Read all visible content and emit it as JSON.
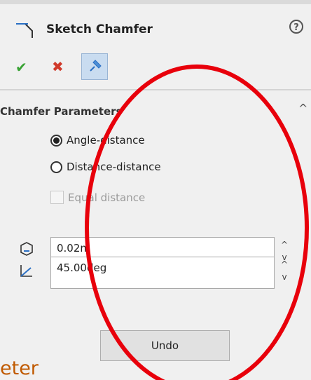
{
  "header": {
    "title": "Sketch Chamfer",
    "help_glyph": "?",
    "icons": {
      "feature": "sketch-chamfer-icon",
      "help": "help-icon"
    }
  },
  "actions": {
    "ok_glyph": "✔",
    "cancel_glyph": "✖",
    "icons": {
      "ok": "check-icon",
      "cancel": "close-icon",
      "pin": "pushpin-icon"
    }
  },
  "section": {
    "title": "Chamfer Parameters",
    "collapse_glyph": "^",
    "options": [
      {
        "label": "Angle-distance",
        "selected": true
      },
      {
        "label": "Distance-distance",
        "selected": false
      }
    ],
    "equal_distance": {
      "label": "Equal distance",
      "checked": false,
      "enabled": false
    },
    "distance": {
      "value": "0.02m",
      "icon": "distance-icon"
    },
    "angle": {
      "value": "45.00deg",
      "icon": "angle-icon"
    },
    "spin_up": "^",
    "spin_down": "v",
    "undo_label": "Undo"
  },
  "overlay": {
    "partial_text": "eter",
    "annotation": "red-ellipse-highlight",
    "colors": {
      "ellipse": "#e8000b",
      "text": "#c05a00"
    }
  }
}
